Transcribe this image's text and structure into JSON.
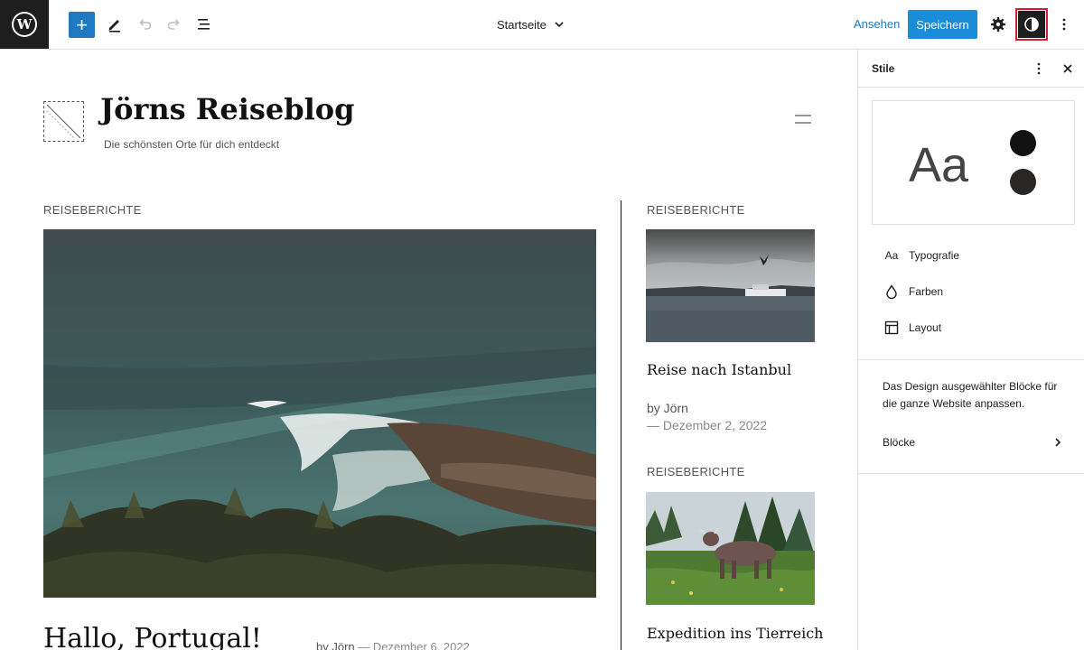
{
  "toolbar": {
    "document_title": "Startseite",
    "view_label": "Ansehen",
    "save_label": "Speichern",
    "add_symbol": "+"
  },
  "site": {
    "title": "Jörns Reiseblog",
    "tagline": "Die schönsten Orte für dich entdeckt"
  },
  "main_post": {
    "category": "REISEBERICHTE",
    "title": "Hallo, Portugal!",
    "author": "by Jörn",
    "date": "— Dezember 6, 2022"
  },
  "side_posts": [
    {
      "category": "REISEBERICHTE",
      "title": "Reise nach Istanbul",
      "author": "by Jörn",
      "date": "— Dezember 2, 2022"
    },
    {
      "category": "REISEBERICHTE",
      "title": "Expedition ins Tierreich"
    }
  ],
  "sidebar": {
    "title": "Stile",
    "preview_text": "Aa",
    "items": [
      {
        "label": "Typografie",
        "icon": "typography-icon",
        "glyph": "Aa"
      },
      {
        "label": "Farben",
        "icon": "color-drop-icon"
      },
      {
        "label": "Layout",
        "icon": "layout-icon"
      }
    ],
    "description": "Das Design ausgewählter Blöcke für die ganze Website anpassen.",
    "blocks_label": "Blöcke"
  },
  "colors": {
    "accent": "#1e78c2",
    "save_button": "#1a8cd8",
    "highlight_border": "#d4202a",
    "preview_dot_1": "#111111",
    "preview_dot_2": "#2a2624"
  }
}
